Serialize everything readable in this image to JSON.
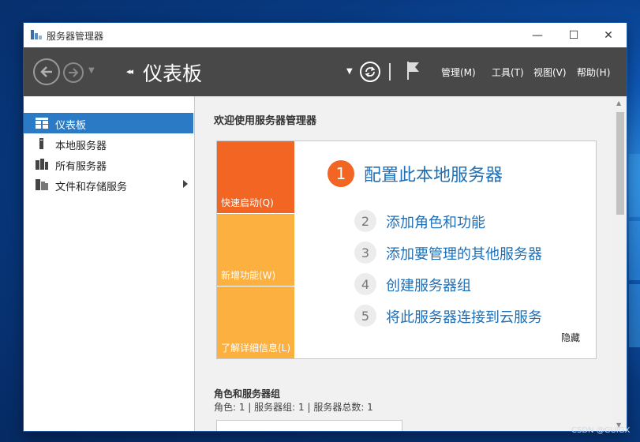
{
  "window": {
    "title": "服务器管理器",
    "minimize": "—",
    "maximize": "☐",
    "close": "✕"
  },
  "toolbar": {
    "breadcrumb_arrows": "◂◂",
    "page_title": "仪表板",
    "menus": [
      "管理(M)",
      "工具(T)",
      "视图(V)",
      "帮助(H)"
    ]
  },
  "sidebar": {
    "items": [
      {
        "label": "仪表板",
        "icon": "dashboard-icon",
        "active": true
      },
      {
        "label": "本地服务器",
        "icon": "server-icon",
        "active": false
      },
      {
        "label": "所有服务器",
        "icon": "servers-icon",
        "active": false
      },
      {
        "label": "文件和存储服务",
        "icon": "storage-icon",
        "active": false,
        "has_submenu": true
      }
    ]
  },
  "main": {
    "welcome_title": "欢迎使用服务器管理器",
    "tiles": [
      {
        "label": "快速启动(Q)",
        "color": "#f26522"
      },
      {
        "label": "新增功能(W)",
        "color": "#fbb040"
      },
      {
        "label": "了解详细信息(L)",
        "color": "#fbb040"
      }
    ],
    "main_step": {
      "number": "1",
      "text": "配置此本地服务器"
    },
    "sub_steps": [
      {
        "number": "2",
        "text": "添加角色和功能"
      },
      {
        "number": "3",
        "text": "添加要管理的其他服务器"
      },
      {
        "number": "4",
        "text": "创建服务器组"
      },
      {
        "number": "5",
        "text": "将此服务器连接到云服务"
      }
    ],
    "hide_label": "隐藏",
    "roles_title": "角色和服务器组",
    "roles_summary": "角色: 1 | 服务器组: 1 | 服务器总数: 1"
  },
  "watermark": "CSDN @GUIGX",
  "colors": {
    "accent": "#2a7ac6",
    "toolbar": "#484848",
    "orange": "#f26522",
    "amber": "#fbb040",
    "link": "#1f6fb5"
  }
}
